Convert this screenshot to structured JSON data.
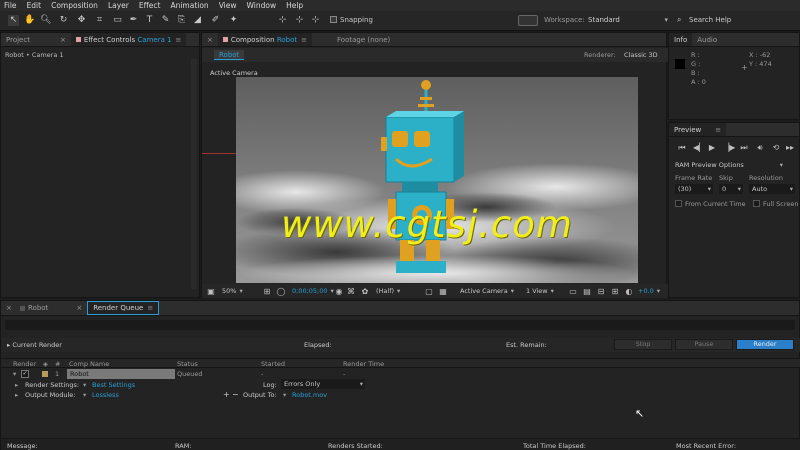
{
  "menu": [
    "File",
    "Edit",
    "Composition",
    "Layer",
    "Effect",
    "Animation",
    "View",
    "Window",
    "Help"
  ],
  "toolbar": {
    "snapping_label": "Snapping",
    "workspace_label": "Workspace:",
    "workspace_value": "Standard",
    "search_placeholder": "Search Help"
  },
  "left_panel": {
    "tab_project": "Project",
    "tab_effect_controls": "Effect Controls",
    "effect_target": "Camera 1",
    "breadcrumb": "Robot • Camera 1"
  },
  "comp_panel": {
    "tab_prefix": "Composition",
    "tab_comp": "Robot",
    "tab_footage": "Footage (none)",
    "comp_button": "Robot",
    "renderer_label": "Renderer:",
    "renderer_value": "Classic 3D",
    "view_label": "Active Camera",
    "watermark": "www.cgtsj.com",
    "zoom": "50%",
    "timecode": "0;00;05;00",
    "resolution": "(Half)",
    "camera": "Active Camera",
    "views": "1 View",
    "exposure": "+0.0"
  },
  "info_panel": {
    "tab_info": "Info",
    "tab_audio": "Audio",
    "r": "R :",
    "g": "G :",
    "b": "B :",
    "a": "A :  0",
    "x": "X : -62",
    "y": "Y : 474"
  },
  "preview_panel": {
    "title": "Preview",
    "ram_options": "RAM Preview Options",
    "frame_rate_label": "Frame Rate",
    "frame_rate_value": "(30)",
    "skip_label": "Skip",
    "skip_value": "0",
    "resolution_label": "Resolution",
    "resolution_value": "Auto",
    "from_current": "From Current Time",
    "full_screen": "Full Screen"
  },
  "bottom_tabs": {
    "robot": "Robot",
    "render_queue": "Render Queue"
  },
  "render_queue": {
    "current_render": "Current Render",
    "elapsed_label": "Elapsed:",
    "est_remain_label": "Est. Remain:",
    "stop": "Stop",
    "pause": "Pause",
    "render": "Render",
    "col_render": "Render",
    "col_num": "#",
    "col_comp": "Comp Name",
    "col_status": "Status",
    "col_started": "Started",
    "col_render_time": "Render Time",
    "item": {
      "num": "1",
      "comp": "Robot",
      "status": "Queued",
      "started": "-",
      "render_time": "-"
    },
    "render_settings_label": "Render Settings:",
    "render_settings_value": "Best Settings",
    "log_label": "Log:",
    "log_value": "Errors Only",
    "output_module_label": "Output Module:",
    "output_module_value": "Lossless",
    "output_to_label": "Output To:",
    "output_to_value": "Robot.mov"
  },
  "status_bar": {
    "message": "Message:",
    "ram": "RAM:",
    "renders_started": "Renders Started:",
    "total_elapsed": "Total Time Elapsed:",
    "recent_error": "Most Recent Error:"
  },
  "colors": {
    "accent": "#2a9fd6",
    "robot": "#2bb0c8",
    "robot_gold": "#e0a020",
    "watermark": "#f2ee1a",
    "render_button": "#2a7fc8"
  }
}
